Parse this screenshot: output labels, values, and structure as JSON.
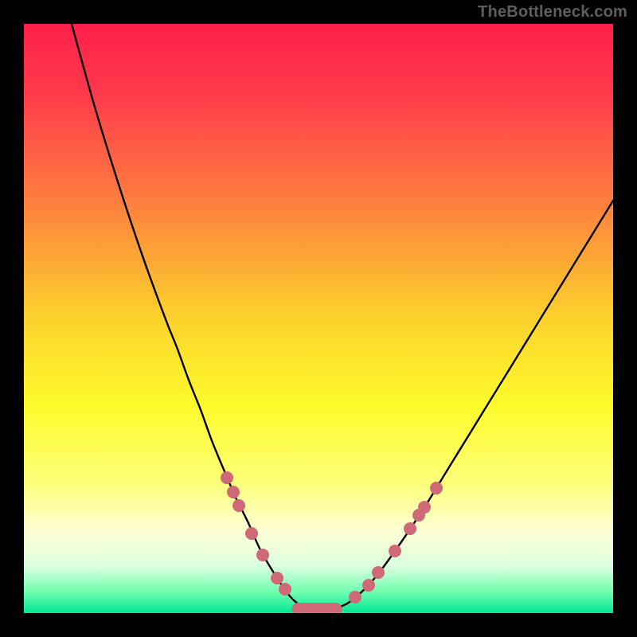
{
  "watermark": "TheBottleneck.com",
  "colors": {
    "background": "#000000",
    "dot": "#cf6977",
    "curve": "#000000",
    "gradient_stops": [
      {
        "offset": 0.0,
        "color": "#ff1f4a"
      },
      {
        "offset": 0.12,
        "color": "#ff3b4b"
      },
      {
        "offset": 0.3,
        "color": "#fd7e3e"
      },
      {
        "offset": 0.5,
        "color": "#fcd22c"
      },
      {
        "offset": 0.65,
        "color": "#fefb2c"
      },
      {
        "offset": 0.78,
        "color": "#fdff7a"
      },
      {
        "offset": 0.86,
        "color": "#feffd3"
      },
      {
        "offset": 0.92,
        "color": "#dcffdf"
      },
      {
        "offset": 0.965,
        "color": "#6dfeae"
      },
      {
        "offset": 1.0,
        "color": "#00e793"
      }
    ]
  },
  "chart_data": {
    "type": "line",
    "title": "",
    "xlabel": "",
    "ylabel": "",
    "xlim": [
      0,
      100
    ],
    "ylim": [
      0,
      100
    ],
    "series": [
      {
        "name": "curve",
        "x": [
          8.1,
          12,
          16,
          20,
          24,
          26,
          28,
          30,
          32,
          34.5,
          36,
          38,
          40,
          42,
          44.3,
          46,
          48,
          50.3,
          54,
          57,
          60,
          64,
          68,
          72,
          76,
          80,
          84,
          88,
          92,
          96,
          100
        ],
        "values": [
          100,
          86,
          73,
          61,
          50,
          45,
          39.5,
          34.5,
          29,
          23,
          19.5,
          15.5,
          11,
          7.5,
          4,
          2,
          0.8,
          0.6,
          1.2,
          3.3,
          6.5,
          12,
          18,
          24.5,
          31,
          37.5,
          44,
          50.5,
          57,
          63.5,
          70
        ]
      }
    ],
    "markers": [
      {
        "x": 34.5,
        "y": 23.0
      },
      {
        "x": 35.5,
        "y": 20.5
      },
      {
        "x": 36.5,
        "y": 18.3
      },
      {
        "x": 38.7,
        "y": 13.5
      },
      {
        "x": 40.6,
        "y": 9.8
      },
      {
        "x": 43.0,
        "y": 6.0
      },
      {
        "x": 44.3,
        "y": 4.0
      },
      {
        "x": 56.2,
        "y": 2.7
      },
      {
        "x": 58.5,
        "y": 4.7
      },
      {
        "x": 60.2,
        "y": 6.9
      },
      {
        "x": 63.0,
        "y": 10.6
      },
      {
        "x": 65.5,
        "y": 14.3
      },
      {
        "x": 67.0,
        "y": 16.6
      },
      {
        "x": 68.0,
        "y": 18.0
      },
      {
        "x": 70.0,
        "y": 21.2
      }
    ],
    "flat_segment": {
      "x_start": 45.5,
      "x_end": 54.0,
      "y": 0.7
    }
  }
}
